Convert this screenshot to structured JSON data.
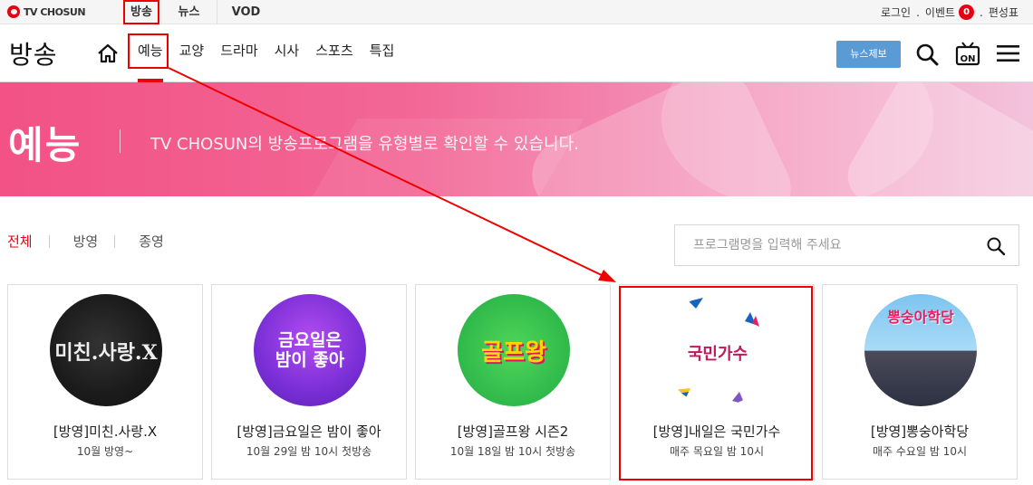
{
  "topbar": {
    "logo_text": "TV CHOSUN",
    "nav": [
      "방송",
      "뉴스",
      "VOD"
    ],
    "login": "로그인",
    "event": "이벤트",
    "event_count": "0",
    "schedule": "편성표",
    "dot": "."
  },
  "header": {
    "page_title": "방송",
    "categories": [
      "예능",
      "교양",
      "드라마",
      "시사",
      "스포츠",
      "특집"
    ],
    "active_category": "예능",
    "news_tip_label": "뉴스제보",
    "on_label": "ON"
  },
  "hero": {
    "title": "예능",
    "subtitle": "TV CHOSUN의 방송프로그램을 유형별로 확인할 수 있습니다."
  },
  "filters": {
    "items": [
      "전체",
      "방영",
      "종영"
    ],
    "active": "전체"
  },
  "search": {
    "placeholder": "프로그램명을 입력해 주세요",
    "value": ""
  },
  "programs": [
    {
      "title": "[방영]미친.사랑.X",
      "schedule": "10월 방영~",
      "thumb_text": "미친.사랑.X"
    },
    {
      "title": "[방영]금요일은 밤이 좋아",
      "schedule": "10월 29일 밤 10시 첫방송",
      "thumb_text": "금요일은 밤이 좋아"
    },
    {
      "title": "[방영]골프왕 시즌2",
      "schedule": "10월 18일 밤 10시 첫방송",
      "thumb_text": "골프왕"
    },
    {
      "title": "[방영]내일은 국민가수",
      "schedule": "매주 목요일 밤 10시",
      "thumb_text": "국민가수"
    },
    {
      "title": "[방영]뽕숭아학당",
      "schedule": "매주 수요일 밤 10시",
      "thumb_text": "뽕숭아학당"
    }
  ],
  "colors": {
    "brand_red": "#e60012",
    "tip_blue": "#5b9bd5",
    "hero_pink": "#f25285",
    "annotation_red": "#ee0000"
  }
}
